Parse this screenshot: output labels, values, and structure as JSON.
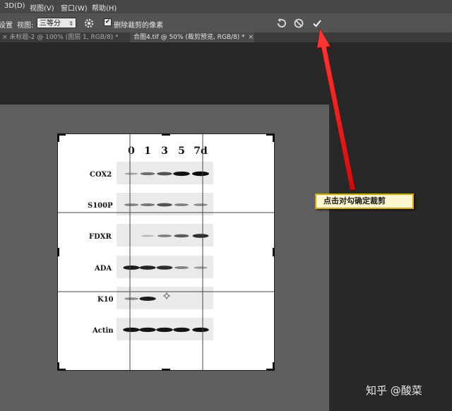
{
  "menubar": {
    "items": [
      {
        "label": "3D(D)"
      },
      {
        "label": "视图(V)"
      },
      {
        "label": "窗口(W)"
      },
      {
        "label": "帮助(H)"
      }
    ]
  },
  "options_bar": {
    "partial_label": "设置",
    "view_label": "视图:",
    "view_value": "三等分",
    "delete_cropped_label": "删除裁剪的像素",
    "delete_cropped_checked": true,
    "undo_icon": "rotate-ccw-icon",
    "cancel_icon": "cancel-circle-icon",
    "commit_icon": "checkmark-icon"
  },
  "tabs": [
    {
      "label": "× 未标题-2 @ 100% (图层 1, RGB/8) *",
      "active": false
    },
    {
      "label": "合图4.tif @ 50% (裁剪预览, RGB/8) *",
      "active": true
    }
  ],
  "figure": {
    "timepoints": [
      "0",
      "1",
      "3",
      "5",
      "7d"
    ],
    "rows": [
      {
        "label": "COX2",
        "intensity": [
          0.15,
          0.45,
          0.6,
          0.95,
          1.0
        ]
      },
      {
        "label": "S100P",
        "intensity": [
          0.35,
          0.4,
          0.6,
          0.35,
          0.3
        ]
      },
      {
        "label": "FDXR",
        "intensity": [
          0.0,
          0.05,
          0.35,
          0.55,
          0.8
        ]
      },
      {
        "label": "ADA",
        "intensity": [
          0.9,
          0.85,
          0.8,
          0.35,
          0.2
        ]
      },
      {
        "label": "K10",
        "intensity": [
          0.3,
          0.9,
          0.0,
          0.0,
          0.0
        ]
      },
      {
        "label": "Actin",
        "intensity": [
          0.95,
          0.95,
          0.95,
          0.95,
          0.95
        ]
      }
    ]
  },
  "annotation": {
    "text": "点击对勾确定裁剪",
    "color": "#e81e1e"
  },
  "watermark": "知乎 @酸菜"
}
